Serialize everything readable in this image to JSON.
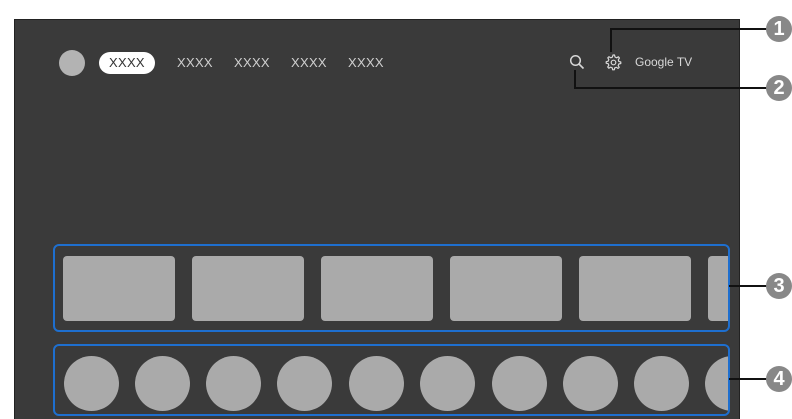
{
  "header": {
    "tabs": [
      {
        "label": "XXXX",
        "active": true
      },
      {
        "label": "XXXX",
        "active": false
      },
      {
        "label": "XXXX",
        "active": false
      },
      {
        "label": "XXXX",
        "active": false
      },
      {
        "label": "XXXX",
        "active": false
      }
    ],
    "brand_label": "Google TV",
    "icons": [
      "search-icon",
      "settings-icon"
    ]
  },
  "callouts": [
    "1",
    "2",
    "3",
    "4"
  ],
  "colors": {
    "screen_bg": "#3a3a3a",
    "placeholder": "#aaaaaa",
    "highlight": "#1e6fcf",
    "callout": "#888888"
  }
}
